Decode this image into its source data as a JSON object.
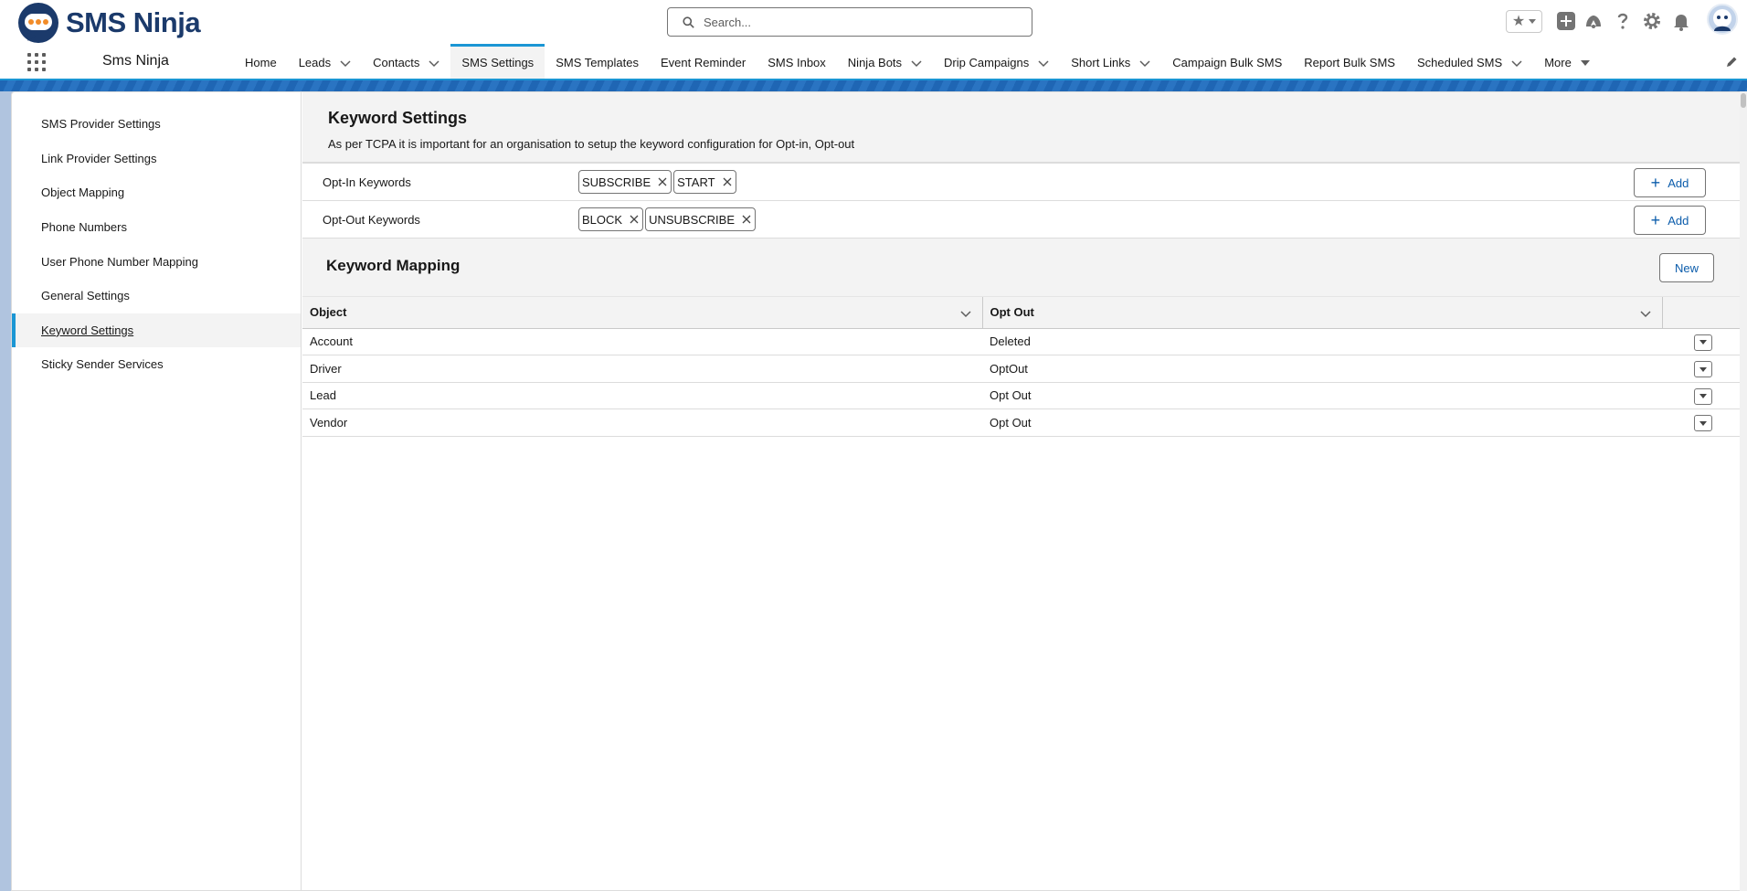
{
  "app": {
    "logo_text": "SMS Ninja",
    "app_name": "Sms Ninja"
  },
  "search": {
    "placeholder": "Search..."
  },
  "nav": {
    "items": [
      {
        "label": "Home"
      },
      {
        "label": "Leads"
      },
      {
        "label": "Contacts"
      },
      {
        "label": "SMS Settings"
      },
      {
        "label": "SMS Templates"
      },
      {
        "label": "Event Reminder"
      },
      {
        "label": "SMS Inbox"
      },
      {
        "label": "Ninja Bots"
      },
      {
        "label": "Drip Campaigns"
      },
      {
        "label": "Short Links"
      },
      {
        "label": "Campaign Bulk SMS"
      },
      {
        "label": "Report Bulk SMS"
      },
      {
        "label": "Scheduled SMS"
      },
      {
        "label": "More"
      }
    ],
    "active": "SMS Settings"
  },
  "sidebar": {
    "items": [
      {
        "label": "SMS Provider Settings"
      },
      {
        "label": "Link Provider Settings"
      },
      {
        "label": "Object Mapping"
      },
      {
        "label": "Phone Numbers"
      },
      {
        "label": "User Phone Number Mapping"
      },
      {
        "label": "General Settings"
      },
      {
        "label": "Keyword Settings"
      },
      {
        "label": "Sticky Sender Services"
      }
    ],
    "active": "Keyword Settings"
  },
  "keyword_settings": {
    "title": "Keyword Settings",
    "description": "As per TCPA it is important for an organisation to setup the keyword configuration for Opt-in, Opt-out",
    "opt_in": {
      "label": "Opt-In Keywords",
      "keywords": [
        "SUBSCRIBE",
        "START"
      ],
      "add_label": "Add"
    },
    "opt_out": {
      "label": "Opt-Out Keywords",
      "keywords": [
        "BLOCK",
        "UNSUBSCRIBE"
      ],
      "add_label": "Add"
    }
  },
  "keyword_mapping": {
    "title": "Keyword Mapping",
    "new_label": "New",
    "columns": [
      "Object",
      "Opt Out"
    ],
    "rows": [
      {
        "object": "Account",
        "opt_out": "Deleted"
      },
      {
        "object": "Driver",
        "opt_out": "OptOut"
      },
      {
        "object": "Lead",
        "opt_out": "Opt Out"
      },
      {
        "object": "Vendor",
        "opt_out": "Opt Out"
      }
    ]
  },
  "colors": {
    "brand": "#1b3a6b",
    "accent": "#1b96d4",
    "link": "#0b5cab"
  },
  "icons": [
    "search-icon",
    "favorites-star-icon",
    "add-icon",
    "trailhead-icon",
    "help-icon",
    "setup-gear-icon",
    "notifications-bell-icon",
    "avatar-icon",
    "app-launcher-icon",
    "edit-pencil-icon",
    "chevron-down-icon",
    "close-icon",
    "plus-icon"
  ]
}
